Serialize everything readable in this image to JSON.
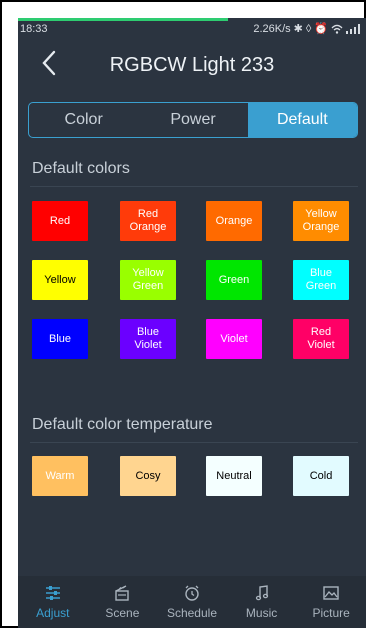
{
  "status": {
    "time": "18:33",
    "speed": "2.26K/s",
    "icons": [
      "bluetooth-icon",
      "nfc-icon",
      "alarm-icon",
      "wifi-icon",
      "signal-icon"
    ]
  },
  "header": {
    "title": "RGBCW Light 233"
  },
  "tabs_top": {
    "color": "Color",
    "power": "Power",
    "default": "Default",
    "active": "default"
  },
  "default_colors": {
    "title": "Default colors",
    "items": [
      {
        "label": "Red",
        "bg": "#ff0000",
        "fg": "#ffffff"
      },
      {
        "label": "Red\nOrange",
        "bg": "#ff3b0a",
        "fg": "#ffffff"
      },
      {
        "label": "Orange",
        "bg": "#ff6a00",
        "fg": "#ffffff"
      },
      {
        "label": "Yellow\nOrange",
        "bg": "#ff8c00",
        "fg": "#ffffff"
      },
      {
        "label": "Yellow",
        "bg": "#ffff00",
        "fg": "#000000"
      },
      {
        "label": "Yellow\nGreen",
        "bg": "#99ff00",
        "fg": "#ffffff"
      },
      {
        "label": "Green",
        "bg": "#00e600",
        "fg": "#ffffff"
      },
      {
        "label": "Blue\nGreen",
        "bg": "#00ffff",
        "fg": "#ffffff"
      },
      {
        "label": "Blue",
        "bg": "#0000ff",
        "fg": "#ffffff"
      },
      {
        "label": "Blue\nViolet",
        "bg": "#6b00ff",
        "fg": "#ffffff"
      },
      {
        "label": "Violet",
        "bg": "#ff00ff",
        "fg": "#ffffff"
      },
      {
        "label": "Red\nViolet",
        "bg": "#ff0066",
        "fg": "#ffffff"
      }
    ]
  },
  "default_temps": {
    "title": "Default color temperature",
    "items": [
      {
        "label": "Warm",
        "bg": "#ffc060",
        "fg": "#ffffff"
      },
      {
        "label": "Cosy",
        "bg": "#ffd590",
        "fg": "#000000"
      },
      {
        "label": "Neutral",
        "bg": "#f4ffff",
        "fg": "#000000"
      },
      {
        "label": "Cold",
        "bg": "#e2fbff",
        "fg": "#000000"
      }
    ]
  },
  "bottom_tabs": [
    {
      "label": "Adjust",
      "icon": "sliders-icon",
      "active": true
    },
    {
      "label": "Scene",
      "icon": "scene-icon",
      "active": false
    },
    {
      "label": "Schedule",
      "icon": "alarm-clock-icon",
      "active": false
    },
    {
      "label": "Music",
      "icon": "music-note-icon",
      "active": false
    },
    {
      "label": "Picture",
      "icon": "picture-icon",
      "active": false
    }
  ],
  "colors": {
    "accent": "#3a9fd0",
    "background": "#2b3440",
    "progress": "#2ecc71"
  }
}
